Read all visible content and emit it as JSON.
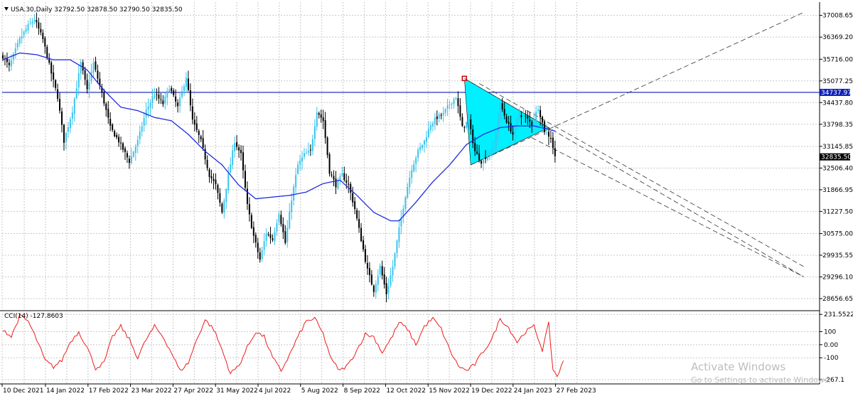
{
  "header": {
    "symbol_label": "USA.30,Daily",
    "ohlc": "32792.50 32878.50 32790.50 32835.50"
  },
  "cci_label": "CCI(14) -127.8603",
  "current_price_tag": "32835.50",
  "horizontal_line_tag": "34737.97",
  "watermark": {
    "title": "Activate Windows",
    "subtitle": "Go to Settings to activate Windows."
  },
  "colors": {
    "bull_candle": "#3ac4ee",
    "bear_candle": "#000000",
    "moving_average": "#1c2ce0",
    "horizontal_line": "#0c1fb8",
    "triangle_fill": "#00f0ff",
    "cci_line": "#ee1c1c",
    "grid": "#c8c8c8"
  },
  "chart_data": [
    {
      "type": "candlestick",
      "title": "USA.30,Daily",
      "ylim": [
        28300,
        37400
      ],
      "x_tick_labels": [
        "10 Dec 2021",
        "14 Jan 2022",
        "17 Feb 2022",
        "23 Mar 2022",
        "27 Apr 2022",
        "31 May 2022",
        "4 Jul 2022",
        "5 Aug 2022",
        "8 Sep 2022",
        "12 Oct 2022",
        "15 Nov 2022",
        "19 Dec 2022",
        "24 Jan 2023",
        "27 Feb 2023"
      ],
      "y_ticks": [
        {
          "value": 37008.65,
          "label": "37008.65"
        },
        {
          "value": 36369.2,
          "label": "36369.20"
        },
        {
          "value": 35716.0,
          "label": "35716.00"
        },
        {
          "value": 35077.25,
          "label": "35077.25"
        },
        {
          "value": 34437.8,
          "label": "34437.80"
        },
        {
          "value": 33798.35,
          "label": "33798.35"
        },
        {
          "value": 33145.85,
          "label": "33145.85"
        },
        {
          "value": 32506.4,
          "label": "32506.40"
        },
        {
          "value": 31866.95,
          "label": "31866.95"
        },
        {
          "value": 31227.5,
          "label": "31227.50"
        },
        {
          "value": 30575.0,
          "label": "30575.00"
        },
        {
          "value": 29935.55,
          "label": "29935.55"
        },
        {
          "value": 29296.1,
          "label": "29296.10"
        },
        {
          "value": 28656.65,
          "label": "28656.65"
        }
      ],
      "price_path_anchors": [
        [
          0,
          35800
        ],
        [
          3,
          35500
        ],
        [
          8,
          36300
        ],
        [
          12,
          36700
        ],
        [
          15,
          36900
        ],
        [
          19,
          36300
        ],
        [
          23,
          35300
        ],
        [
          26,
          34600
        ],
        [
          29,
          33300
        ],
        [
          33,
          34200
        ],
        [
          37,
          35600
        ],
        [
          40,
          34800
        ],
        [
          43,
          35600
        ],
        [
          47,
          34700
        ],
        [
          51,
          33700
        ],
        [
          55,
          33300
        ],
        [
          60,
          32700
        ],
        [
          64,
          33300
        ],
        [
          68,
          34200
        ],
        [
          72,
          34700
        ],
        [
          76,
          34400
        ],
        [
          79,
          34900
        ],
        [
          83,
          34300
        ],
        [
          87,
          35200
        ],
        [
          90,
          33900
        ],
        [
          94,
          33300
        ],
        [
          98,
          32300
        ],
        [
          101,
          32000
        ],
        [
          104,
          31200
        ],
        [
          107,
          32300
        ],
        [
          110,
          33300
        ],
        [
          113,
          32900
        ],
        [
          116,
          31400
        ],
        [
          119,
          30500
        ],
        [
          122,
          29800
        ],
        [
          125,
          30600
        ],
        [
          128,
          30400
        ],
        [
          131,
          31200
        ],
        [
          134,
          30300
        ],
        [
          137,
          31600
        ],
        [
          140,
          32600
        ],
        [
          143,
          32900
        ],
        [
          146,
          33000
        ],
        [
          149,
          34200
        ],
        [
          152,
          33900
        ],
        [
          155,
          32400
        ],
        [
          158,
          32000
        ],
        [
          161,
          32300
        ],
        [
          164,
          32000
        ],
        [
          167,
          31300
        ],
        [
          170,
          30400
        ],
        [
          173,
          29500
        ],
        [
          176,
          28900
        ],
        [
          179,
          29600
        ],
        [
          182,
          28800
        ],
        [
          185,
          29600
        ],
        [
          188,
          30700
        ],
        [
          191,
          31700
        ],
        [
          194,
          32500
        ],
        [
          197,
          33000
        ],
        [
          200,
          33300
        ],
        [
          203,
          33800
        ],
        [
          206,
          34000
        ],
        [
          209,
          34100
        ],
        [
          212,
          34400
        ],
        [
          215,
          34600
        ],
        [
          218,
          33700
        ],
        [
          221,
          33900
        ],
        [
          224,
          33000
        ],
        [
          227,
          32700
        ],
        [
          230,
          32900
        ],
        [
          233,
          33100
        ],
        [
          236,
          34400
        ],
        [
          239,
          33900
        ],
        [
          242,
          33500
        ],
        [
          245,
          34100
        ],
        [
          248,
          34000
        ],
        [
          251,
          33800
        ],
        [
          254,
          34300
        ],
        [
          257,
          33600
        ],
        [
          260,
          33400
        ],
        [
          262,
          32836
        ]
      ],
      "moving_average_anchors": [
        [
          0,
          35700
        ],
        [
          8,
          35900
        ],
        [
          16,
          35850
        ],
        [
          24,
          35700
        ],
        [
          32,
          35700
        ],
        [
          40,
          35400
        ],
        [
          48,
          34800
        ],
        [
          56,
          34300
        ],
        [
          64,
          34200
        ],
        [
          72,
          34000
        ],
        [
          80,
          33900
        ],
        [
          88,
          33500
        ],
        [
          96,
          33000
        ],
        [
          104,
          32600
        ],
        [
          112,
          32000
        ],
        [
          120,
          31600
        ],
        [
          128,
          31650
        ],
        [
          136,
          31700
        ],
        [
          144,
          31800
        ],
        [
          152,
          32050
        ],
        [
          160,
          32150
        ],
        [
          168,
          31700
        ],
        [
          176,
          31200
        ],
        [
          184,
          30950
        ],
        [
          188,
          30950
        ],
        [
          196,
          31500
        ],
        [
          204,
          32100
        ],
        [
          212,
          32600
        ],
        [
          220,
          33200
        ],
        [
          228,
          33500
        ],
        [
          236,
          33700
        ],
        [
          244,
          33750
        ],
        [
          252,
          33750
        ],
        [
          262,
          33600
        ]
      ],
      "horizontal_level": 34737.97,
      "triangle_vertices": [
        [
          219,
          35150
        ],
        [
          222,
          32600
        ],
        [
          259,
          33700
        ]
      ],
      "trend_lines": [
        {
          "from": [
            219,
            35150
          ],
          "to": [
            380,
            29300
          ]
        },
        {
          "from": [
            222,
            32600
          ],
          "to": [
            380,
            37100
          ]
        },
        {
          "from": [
            226,
            35000
          ],
          "to": [
            380,
            29600
          ]
        },
        {
          "from": [
            251,
            33400
          ],
          "to": [
            380,
            29300
          ]
        }
      ]
    },
    {
      "type": "line",
      "title": "CCI(14) -127.8603",
      "ylim": [
        -300,
        260
      ],
      "y_ticks": [
        {
          "value": 231.5522,
          "label": "231.5522"
        },
        {
          "value": 100,
          "label": "100"
        },
        {
          "value": 0,
          "label": "0.00"
        },
        {
          "value": -100,
          "label": "-100"
        },
        {
          "value": -267.1,
          "label": "-267.1"
        }
      ],
      "cci_anchors": [
        [
          0,
          120
        ],
        [
          4,
          60
        ],
        [
          8,
          220
        ],
        [
          12,
          180
        ],
        [
          16,
          40
        ],
        [
          20,
          -120
        ],
        [
          24,
          -170
        ],
        [
          28,
          -120
        ],
        [
          32,
          20
        ],
        [
          36,
          100
        ],
        [
          40,
          -20
        ],
        [
          44,
          -180
        ],
        [
          48,
          -140
        ],
        [
          52,
          60
        ],
        [
          56,
          140
        ],
        [
          60,
          40
        ],
        [
          64,
          -100
        ],
        [
          68,
          40
        ],
        [
          72,
          140
        ],
        [
          76,
          60
        ],
        [
          80,
          -60
        ],
        [
          84,
          -200
        ],
        [
          88,
          -140
        ],
        [
          92,
          40
        ],
        [
          96,
          190
        ],
        [
          100,
          120
        ],
        [
          104,
          -40
        ],
        [
          108,
          -220
        ],
        [
          112,
          -160
        ],
        [
          116,
          -20
        ],
        [
          120,
          100
        ],
        [
          124,
          60
        ],
        [
          128,
          -100
        ],
        [
          132,
          -200
        ],
        [
          136,
          -80
        ],
        [
          140,
          60
        ],
        [
          144,
          180
        ],
        [
          148,
          200
        ],
        [
          152,
          80
        ],
        [
          156,
          -120
        ],
        [
          160,
          -200
        ],
        [
          164,
          -150
        ],
        [
          168,
          -40
        ],
        [
          172,
          80
        ],
        [
          176,
          60
        ],
        [
          180,
          -60
        ],
        [
          184,
          40
        ],
        [
          188,
          170
        ],
        [
          192,
          120
        ],
        [
          196,
          0
        ],
        [
          200,
          140
        ],
        [
          204,
          200
        ],
        [
          208,
          120
        ],
        [
          212,
          -40
        ],
        [
          216,
          -160
        ],
        [
          220,
          -200
        ],
        [
          224,
          -150
        ],
        [
          228,
          -50
        ],
        [
          232,
          40
        ],
        [
          236,
          200
        ],
        [
          240,
          130
        ],
        [
          244,
          20
        ],
        [
          248,
          100
        ],
        [
          252,
          140
        ],
        [
          256,
          -40
        ],
        [
          259,
          160
        ],
        [
          261,
          -190
        ],
        [
          263,
          -240
        ],
        [
          266,
          -130
        ]
      ]
    }
  ]
}
